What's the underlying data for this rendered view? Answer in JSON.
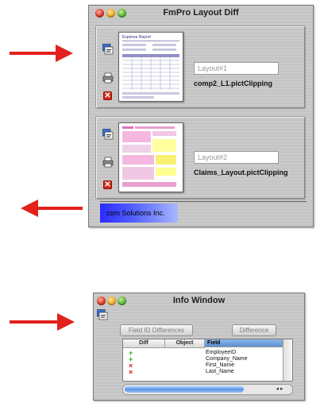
{
  "top_window": {
    "title": "FmPro Layout Diff",
    "layout1": {
      "placeholder": "Layout#1",
      "file": "comp2_L1.pictClipping"
    },
    "layout2": {
      "placeholder": "Layout#2",
      "file": "Claims_Layout.pictClipping"
    },
    "brand": "com Solutions Inc.",
    "thumb1_heading": "Expense Report"
  },
  "info_window": {
    "title": "Info Window",
    "field_id_button": "Field ID Differences",
    "difference_button": "Difference",
    "columns": [
      "Diff",
      "Object",
      "Field"
    ],
    "rows": [
      {
        "diff": "+",
        "field": "EmployeeID"
      },
      {
        "diff": "+",
        "field": "Company_Name"
      },
      {
        "diff": "×",
        "field": "First_Name"
      },
      {
        "diff": "×",
        "field": "Last_Name"
      }
    ]
  },
  "colors": {
    "arrow": "#e2201c",
    "added": "#2aa82a",
    "removed": "#d0201c",
    "brand_gradient_start": "#2b2bff"
  },
  "icons": [
    "stack-icon",
    "printer-icon",
    "delete-icon"
  ]
}
